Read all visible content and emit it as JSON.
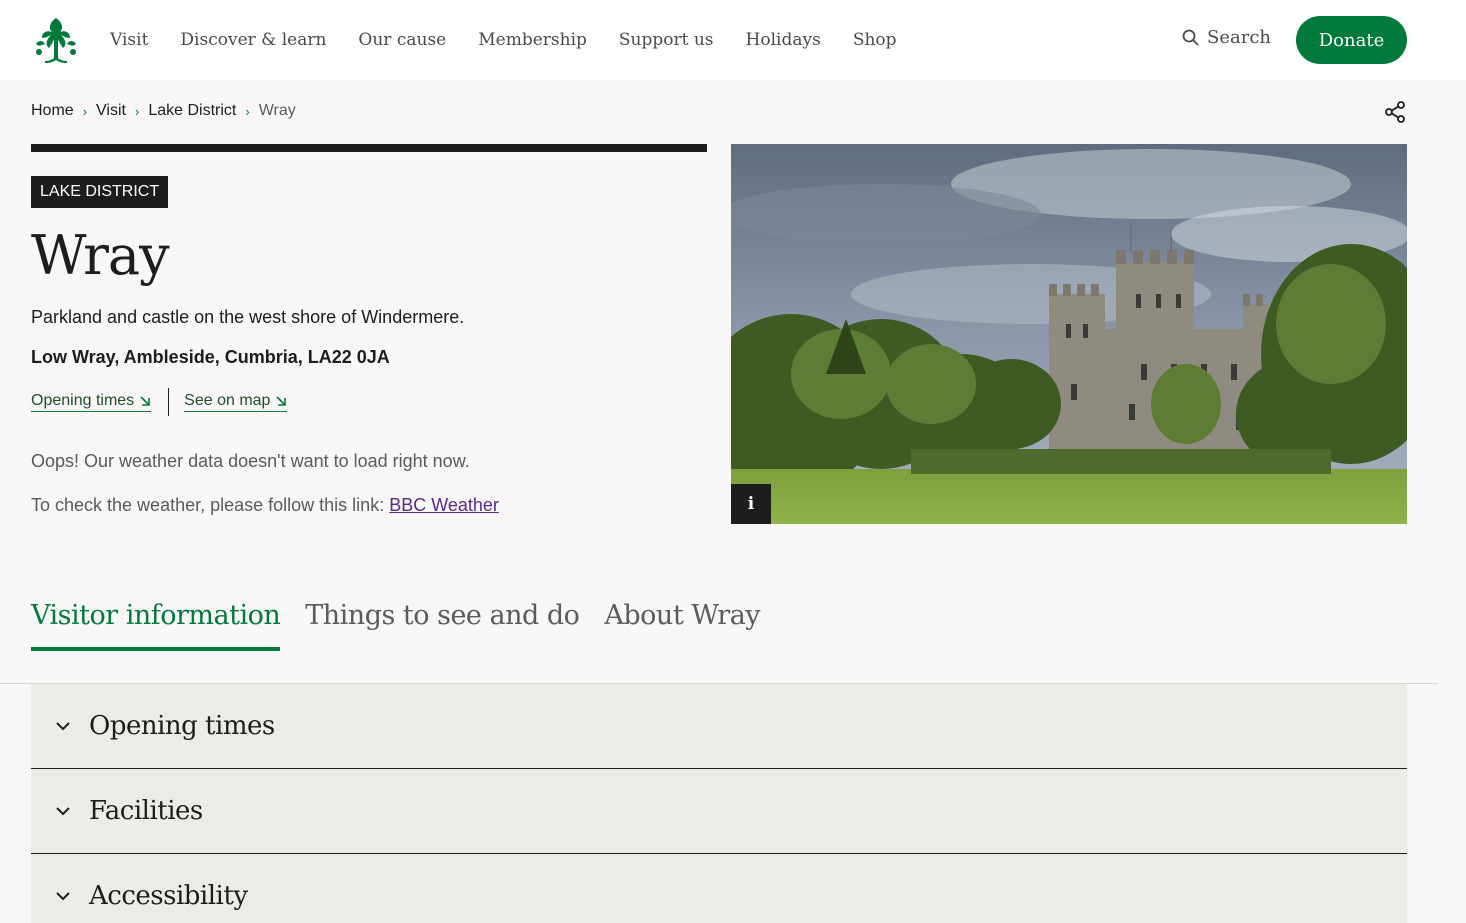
{
  "brand": {
    "logo_icon": "oak-leaf-logo-icon",
    "color": "#007a3b"
  },
  "nav": {
    "items": [
      {
        "label": "Visit"
      },
      {
        "label": "Discover & learn"
      },
      {
        "label": "Our cause"
      },
      {
        "label": "Membership"
      },
      {
        "label": "Support us"
      },
      {
        "label": "Holidays"
      },
      {
        "label": "Shop"
      }
    ],
    "search_label": "Search",
    "donate_label": "Donate"
  },
  "breadcrumb": {
    "items": [
      {
        "label": "Home"
      },
      {
        "label": "Visit"
      },
      {
        "label": "Lake District"
      },
      {
        "label": "Wray"
      }
    ]
  },
  "hero": {
    "tag": "LAKE DISTRICT",
    "title": "Wray",
    "description": "Parkland and castle on the west shore of Windermere.",
    "address": "Low Wray, Ambleside, Cumbria, LA22 0JA",
    "links": {
      "opening_times": "Opening times",
      "see_on_map": "See on map"
    },
    "weather": {
      "error_message": "Oops! Our weather data doesn't want to load right now.",
      "check_prefix": "To check the weather, please follow this link: ",
      "link_label": "BBC Weather"
    },
    "image_info_label": "i"
  },
  "tabs": [
    {
      "label": "Visitor information"
    },
    {
      "label": "Things to see and do"
    },
    {
      "label": "About Wray"
    }
  ],
  "accordion": [
    {
      "label": "Opening times"
    },
    {
      "label": "Facilities"
    },
    {
      "label": "Accessibility"
    }
  ]
}
